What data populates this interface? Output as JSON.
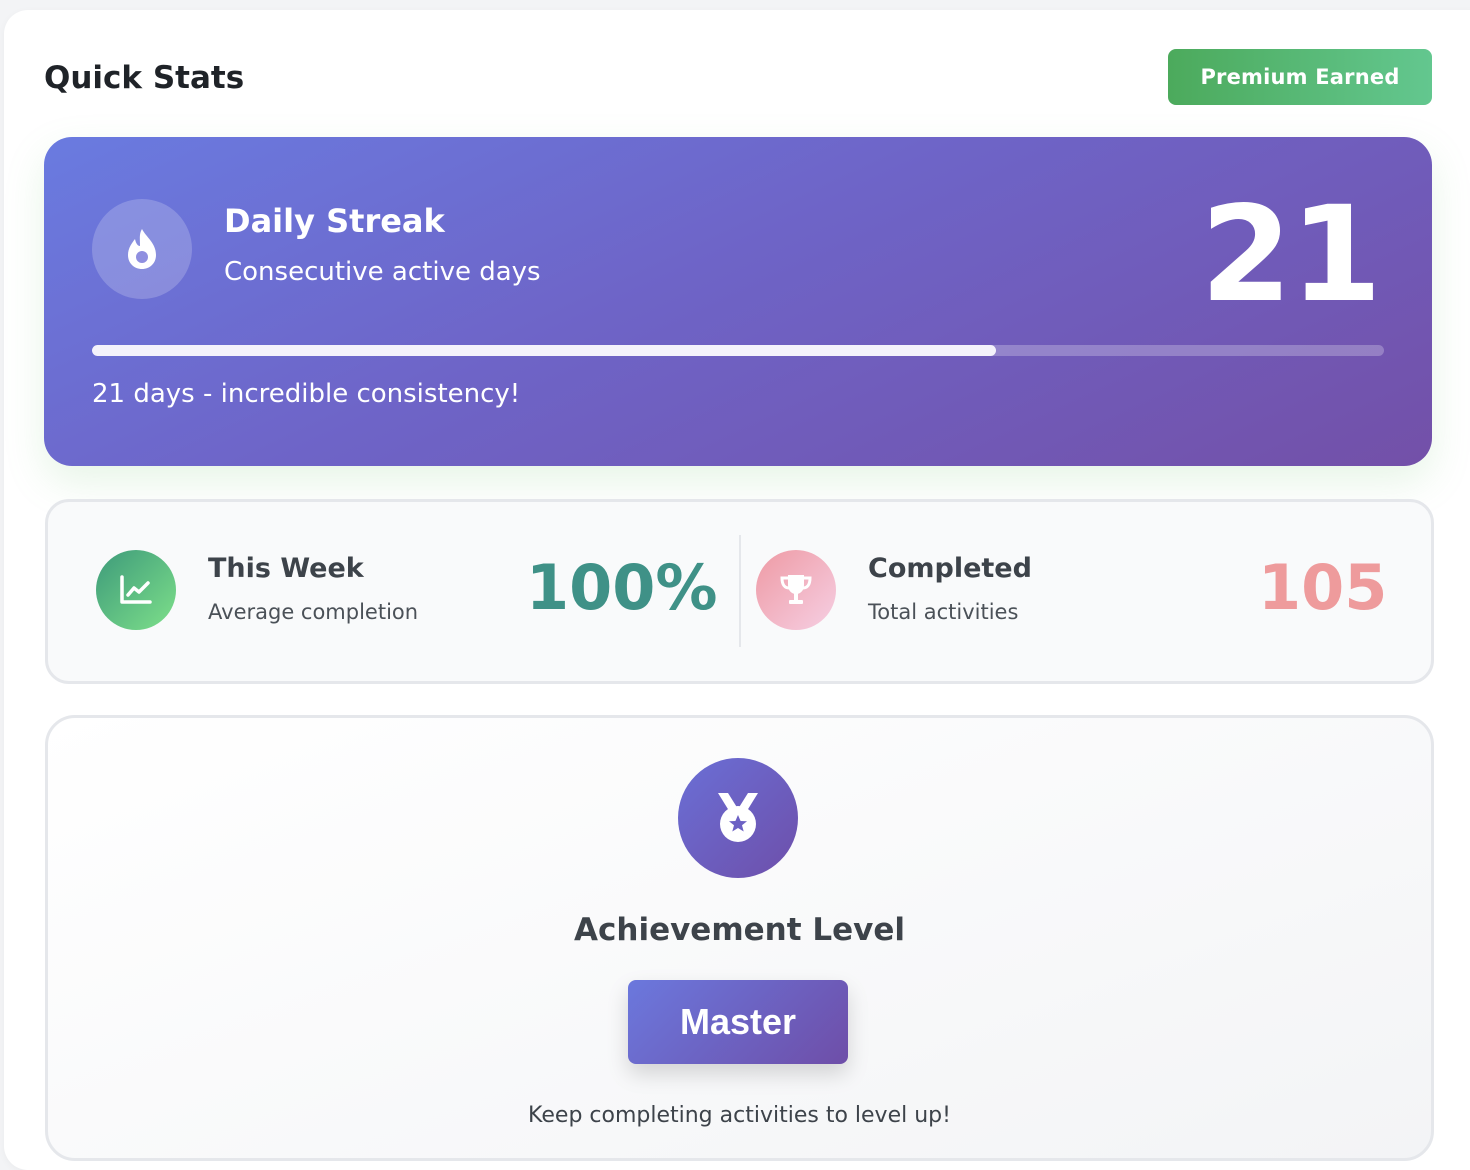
{
  "header": {
    "title": "Quick Stats",
    "badge_label": "Premium Earned"
  },
  "streak": {
    "title": "Daily Streak",
    "subtitle": "Consecutive active days",
    "value": "21",
    "progress": 0.7,
    "message": "21 days - incredible consistency!",
    "icon": "fire-icon"
  },
  "stats": {
    "week": {
      "label": "This Week",
      "sub": "Average completion",
      "value": "100%",
      "icon": "chart-line-icon"
    },
    "completed": {
      "label": "Completed",
      "sub": "Total activities",
      "value": "105",
      "icon": "trophy-icon"
    }
  },
  "achievement": {
    "title": "Achievement Level",
    "level": "Master",
    "message": "Keep completing activities to level up!",
    "icon": "medal-icon"
  },
  "colors": {
    "accent_green": "#3f9187",
    "accent_pink": "#ee9b9c",
    "primary_purple": "#6e64c7",
    "badge_green": "#4caa5c"
  }
}
